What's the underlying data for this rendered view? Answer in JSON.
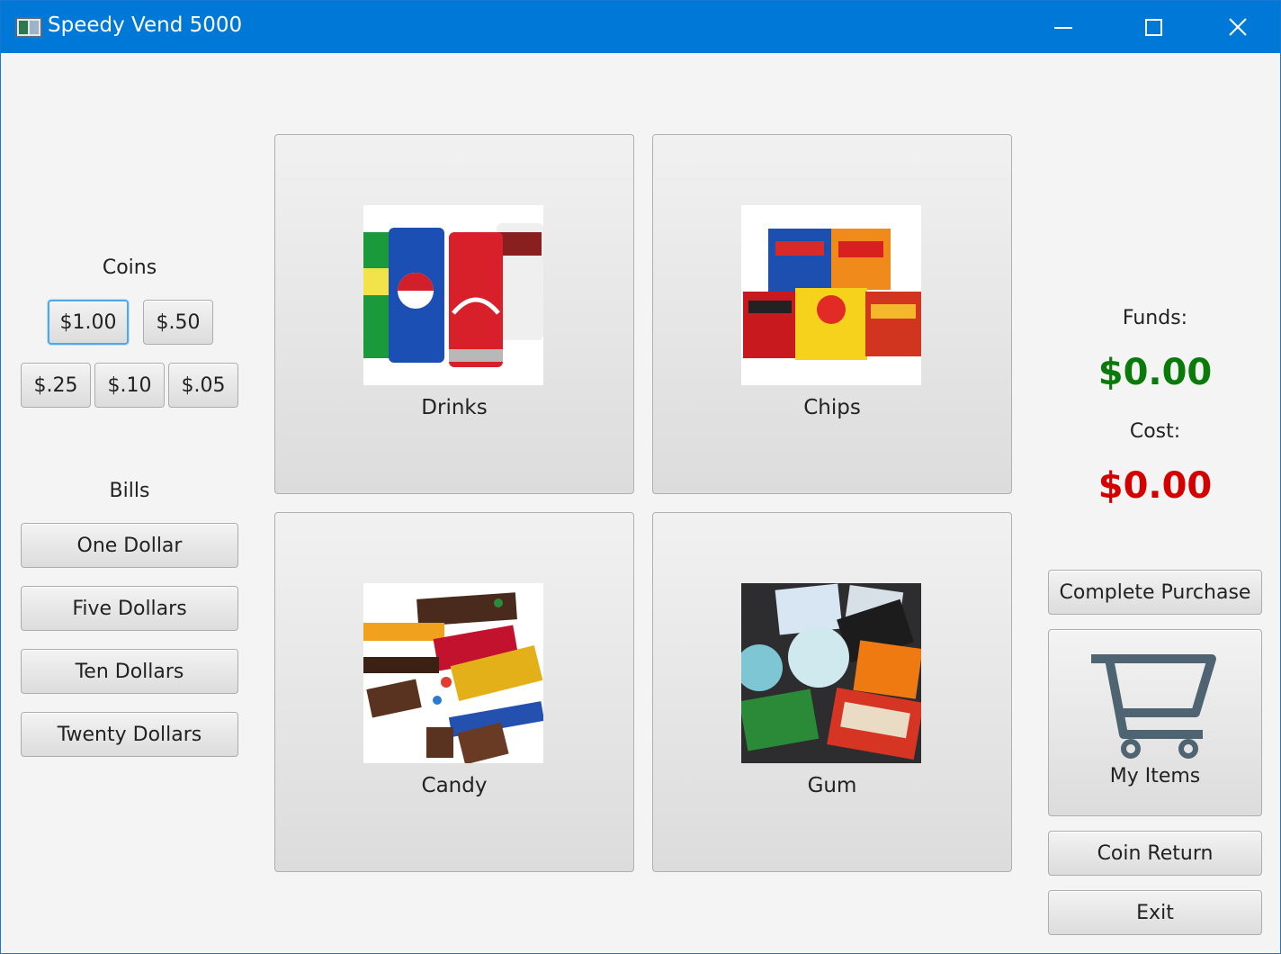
{
  "window": {
    "title": "Speedy Vend 5000"
  },
  "coins": {
    "heading": "Coins",
    "buttons": [
      "$1.00",
      "$.50",
      "$.25",
      "$.10",
      "$.05"
    ]
  },
  "bills": {
    "heading": "Bills",
    "buttons": [
      "One Dollar",
      "Five Dollars",
      "Ten Dollars",
      "Twenty Dollars"
    ]
  },
  "products": [
    {
      "label": "Drinks",
      "icon": "soda-cans-image"
    },
    {
      "label": "Chips",
      "icon": "chip-bags-image"
    },
    {
      "label": "Candy",
      "icon": "candy-bars-image"
    },
    {
      "label": "Gum",
      "icon": "gum-packs-image"
    }
  ],
  "status": {
    "funds_label": "Funds:",
    "funds_value": "$0.00",
    "funds_color": "#0a7a0a",
    "cost_label": "Cost:",
    "cost_value": "$0.00",
    "cost_color": "#d40000"
  },
  "actions": {
    "complete_purchase": "Complete Purchase",
    "my_items": "My Items",
    "my_items_icon": "shopping-cart-icon",
    "coin_return": "Coin Return",
    "exit": "Exit"
  },
  "colors": {
    "titlebar": "#0078d7",
    "cart_icon": "#4f6472"
  }
}
